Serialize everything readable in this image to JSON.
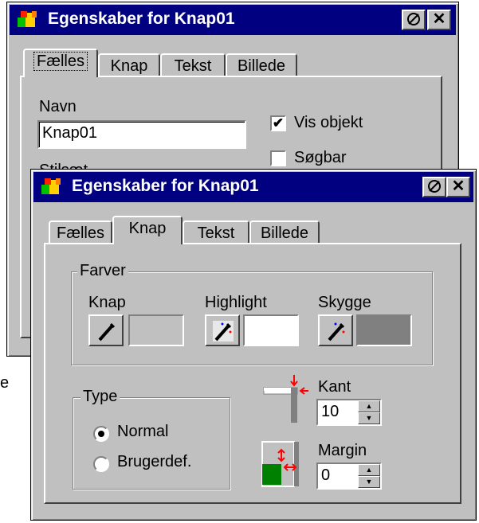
{
  "back_window": {
    "title": "Egenskaber for Knap01",
    "tabs": [
      "Fælles",
      "Knap",
      "Tekst",
      "Billede"
    ],
    "active_tab": "Fælles",
    "name_label": "Navn",
    "name_value": "Knap01",
    "vis_objekt_label": "Vis objekt",
    "vis_objekt_checked": true,
    "soegbar_label": "Søgbar",
    "soegbar_checked": false,
    "stilsaet_partial": "Stilsæt"
  },
  "front_window": {
    "title": "Egenskaber for Knap01",
    "tabs": [
      "Fælles",
      "Knap",
      "Tekst",
      "Billede"
    ],
    "active_tab": "Knap",
    "farver": {
      "title": "Farver",
      "knap_label": "Knap",
      "highlight_label": "Highlight",
      "skygge_label": "Skygge",
      "knap_color": "#c0c0c0",
      "highlight_color": "#ffffff",
      "skygge_color": "#808080"
    },
    "type": {
      "title": "Type",
      "options": [
        "Normal",
        "Brugerdef."
      ],
      "selected": "Normal"
    },
    "kant": {
      "label": "Kant",
      "value": "10"
    },
    "margin": {
      "label": "Margin",
      "value": "0"
    }
  },
  "outside_fragment": "e",
  "icons": {
    "help": "help-icon",
    "close": "close-icon",
    "app": "app-icon",
    "picker": "color-picker-icon"
  }
}
